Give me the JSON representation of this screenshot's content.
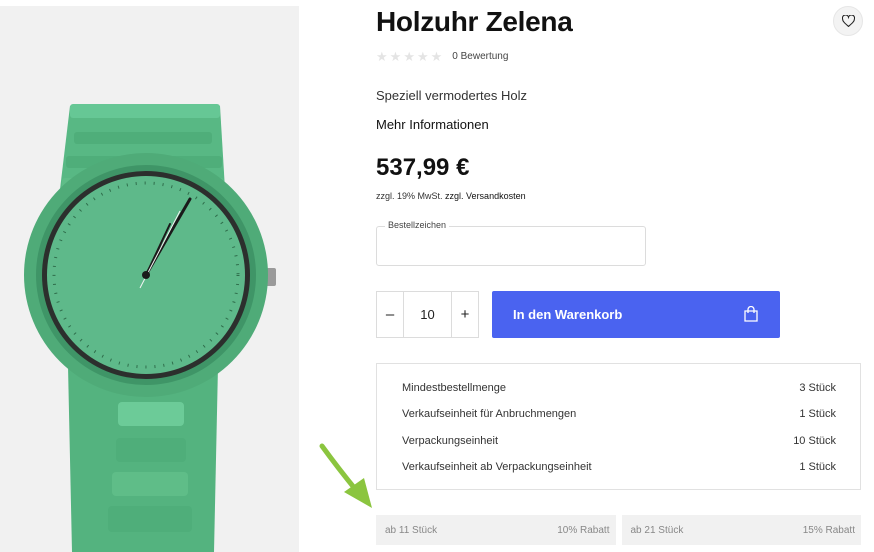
{
  "product": {
    "title": "Holzuhr Zelena",
    "rating_count": "0 Bewertung",
    "description": "Speziell vermodertes Holz",
    "more_info": "Mehr Informationen",
    "price": "537,99 €",
    "tax_note": "zzgl. 19% MwSt.",
    "shipping_link": "zzgl. Versandkosten"
  },
  "order_field": {
    "label": "Bestellzeichen",
    "value": ""
  },
  "quantity": {
    "minus": "–",
    "value": "10",
    "plus": "+"
  },
  "cart_button": {
    "label": "In den Warenkorb"
  },
  "info_rows": [
    {
      "label": "Mindestbestellmenge",
      "value": "3 Stück"
    },
    {
      "label": "Verkaufseinheit für Anbruchmengen",
      "value": "1 Stück"
    },
    {
      "label": "Verpackungseinheit",
      "value": "10 Stück"
    },
    {
      "label": "Verkaufseinheit ab Verpackungseinheit",
      "value": "1 Stück"
    }
  ],
  "tiers": [
    {
      "quantity": "ab 11 Stück",
      "discount": "10% Rabatt"
    },
    {
      "quantity": "ab 21 Stück",
      "discount": "15% Rabatt"
    }
  ],
  "icons": {
    "wishlist": "heart-icon",
    "cart": "shopping-bag-icon",
    "annotation": "arrow-icon"
  },
  "colors": {
    "accent": "#4a63f0",
    "watch_green": "#5fbf8a",
    "annotation_arrow": "#8bc53f"
  }
}
